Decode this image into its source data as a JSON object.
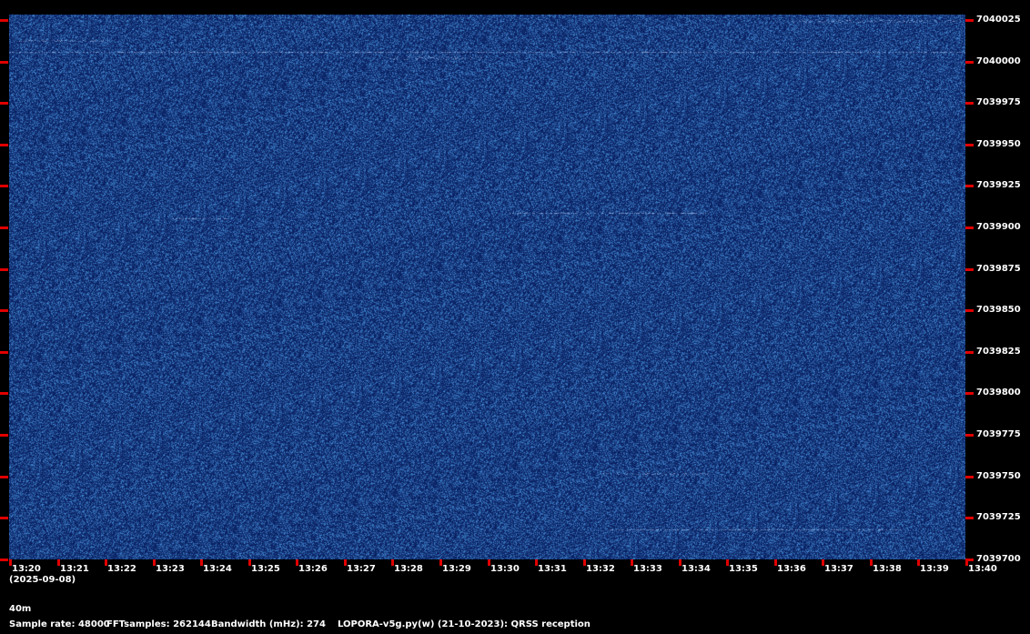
{
  "colors": {
    "background": "#000000",
    "waterfall": "#13357a",
    "tick": "#e00000",
    "text": "#ffffff"
  },
  "frequency_axis": {
    "labels": [
      "7040025",
      "7040000",
      "7039975",
      "7039950",
      "7039925",
      "7039900",
      "7039875",
      "7039850",
      "7039825",
      "7039800",
      "7039775",
      "7039750",
      "7039725",
      "7039700"
    ]
  },
  "time_axis": {
    "labels": [
      "13:20",
      "13:21",
      "13:22",
      "13:23",
      "13:24",
      "13:25",
      "13:26",
      "13:27",
      "13:28",
      "13:29",
      "13:30",
      "13:31",
      "13:32",
      "13:33",
      "13:34",
      "13:35",
      "13:36",
      "13:37",
      "13:38",
      "13:39",
      "13:40"
    ],
    "date": "(2025-09-08)"
  },
  "info": {
    "band": "40m",
    "sample_rate": "Sample rate: 48000",
    "fft_samples": "FFTsamples: 262144",
    "bandwidth": "Bandwidth (mHz): 274",
    "software": "LOPORA-v5g.py(w) (21-10-2023): QRSS reception"
  }
}
